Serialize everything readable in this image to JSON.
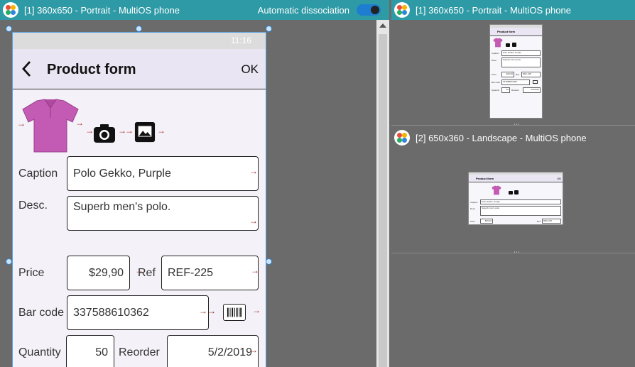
{
  "left_panel": {
    "title": "[1] 360x650 - Portrait - MultiOS phone",
    "auto_dissociation_label": "Automatic dissociation"
  },
  "phone": {
    "time": "11:16",
    "title": "Product form",
    "ok_label": "OK",
    "fields": {
      "caption": {
        "label": "Caption",
        "value": "Polo Gekko, Purple"
      },
      "desc": {
        "label": "Desc.",
        "value": "Superb men's polo."
      },
      "price": {
        "label": "Price",
        "value": "$29,90"
      },
      "ref": {
        "label": "Ref",
        "value": "REF-225"
      },
      "barcode": {
        "label": "Bar code",
        "value": "337588610362"
      },
      "quantity": {
        "label": "Quantity",
        "value": "50"
      },
      "reorder": {
        "label": "Reorder",
        "value": "5/2/2019"
      }
    }
  },
  "right_panel": {
    "preview1_title": "[1] 360x650 - Portrait - MultiOS phone",
    "preview2_title": "[2] 650x360 - Landscape - MultiOS phone"
  },
  "colors": {
    "titlebar": "#2e9aa5",
    "accent_toggle": "#1f7dd1",
    "phone_bg": "#f4f2f8",
    "shirt": "#c35bb4"
  }
}
